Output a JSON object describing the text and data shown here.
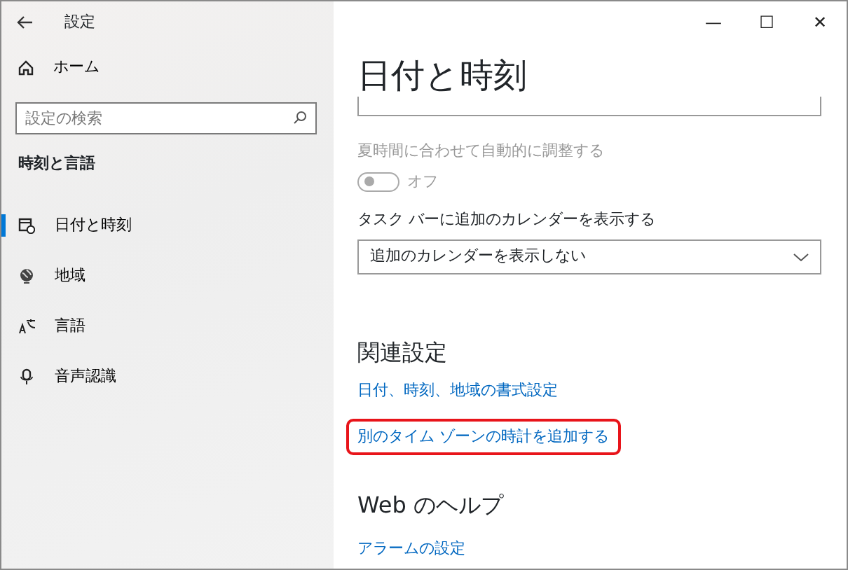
{
  "window": {
    "title": "設定",
    "controls": [
      "—",
      "☐",
      "✕"
    ]
  },
  "sidebar": {
    "home": "ホーム",
    "search": {
      "placeholder": "設定の検索"
    },
    "section": "時刻と言語",
    "items": [
      {
        "label": "日付と時刻",
        "kind": "clock",
        "selected": true
      },
      {
        "label": "地域",
        "kind": "globe",
        "selected": false
      },
      {
        "label": "言語",
        "kind": "language",
        "selected": false
      },
      {
        "label": "音声認識",
        "kind": "mic",
        "selected": false
      }
    ]
  },
  "page": {
    "title": "日付と時刻",
    "dst": {
      "label": "夏時間に合わせて自動的に調整する",
      "disabled": true,
      "on": false,
      "state_text": "オフ"
    },
    "calendar": {
      "label": "タスク バーに追加のカレンダーを表示する",
      "value": "追加のカレンダーを表示しない"
    },
    "related": {
      "heading": "関連設定",
      "links": [
        {
          "text": "日付、時刻、地域の書式設定",
          "highlighted": false
        },
        {
          "text": "別のタイム ゾーンの時計を追加する",
          "highlighted": true
        }
      ]
    },
    "help": {
      "heading": "Web のヘルプ",
      "links": [
        {
          "text": "アラームの設定",
          "highlighted": false
        }
      ]
    }
  }
}
